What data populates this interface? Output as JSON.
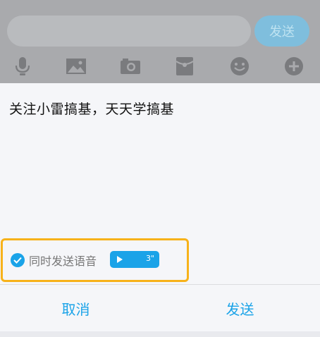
{
  "chat_bar": {
    "send_label": "发送",
    "tools": [
      "microphone-icon",
      "image-icon",
      "camera-icon",
      "red-packet-icon",
      "emoji-icon",
      "plus-icon"
    ]
  },
  "dialog": {
    "message": "关注小雷搞基，天天学搞基",
    "voice_option_label": "同时发送语音",
    "voice_duration": "3\"",
    "cancel_label": "取消",
    "send_label": "发送"
  },
  "colors": {
    "accent": "#1aa3e8",
    "highlight_border": "#f7b21a"
  }
}
